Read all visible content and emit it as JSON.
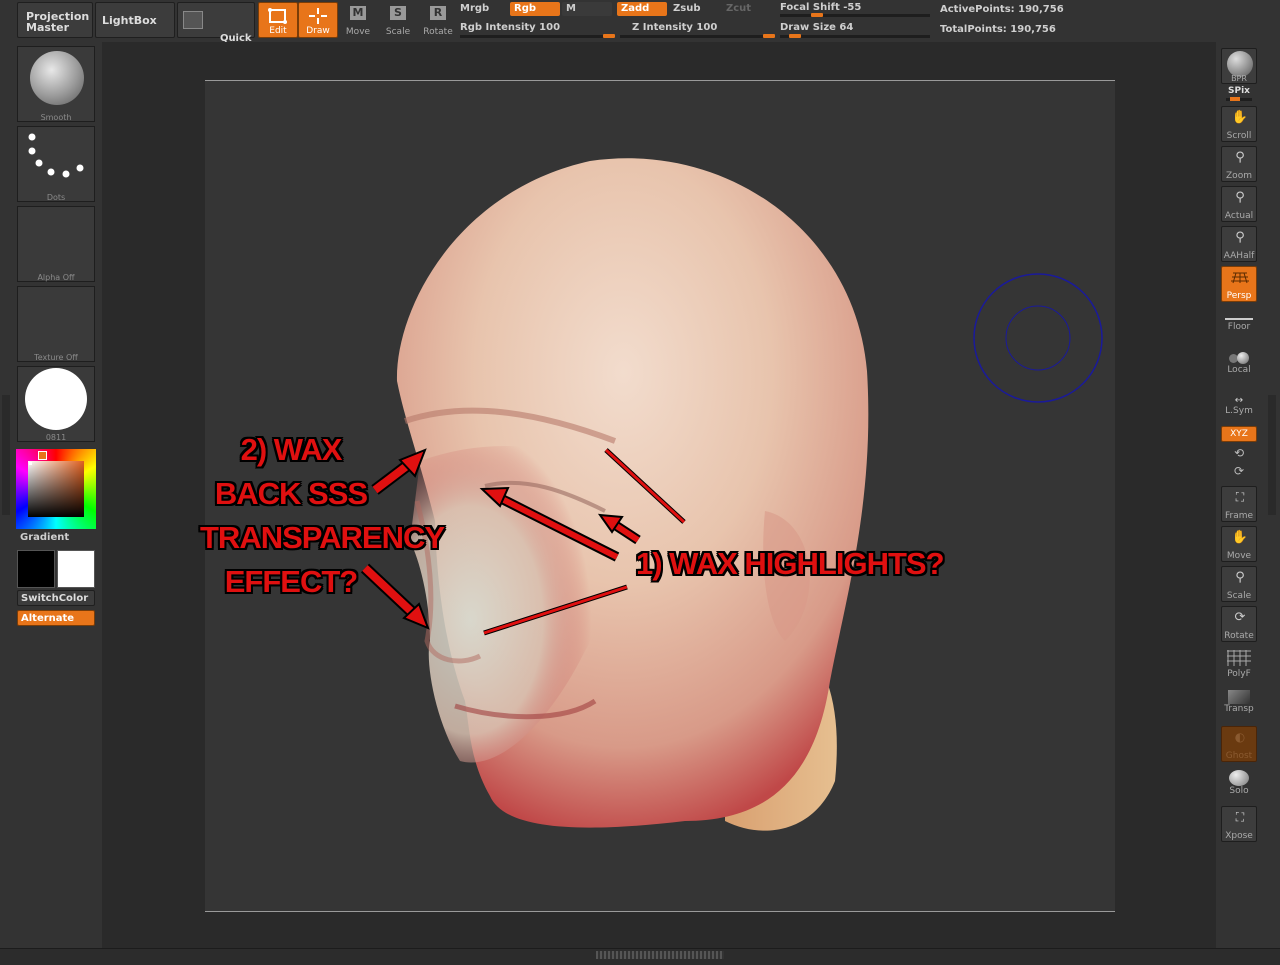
{
  "topbar": {
    "projection_master": "Projection\nMaster",
    "lightbox": "LightBox",
    "quick_sketch": "Quick\nSketch",
    "tools": [
      {
        "label": "Edit",
        "active": true
      },
      {
        "label": "Draw",
        "active": true
      },
      {
        "label": "Move",
        "active": false
      },
      {
        "label": "Scale",
        "active": false
      },
      {
        "label": "Rotate",
        "active": false
      }
    ],
    "mrgb": "Mrgb",
    "rgb": "Rgb",
    "m": "M",
    "rgb_intensity": "Rgb  Intensity 100",
    "zadd": "Zadd",
    "zsub": "Zsub",
    "zcut": "Zcut",
    "z_intensity": "Z  Intensity 100",
    "focal_shift": "Focal  Shift -55",
    "draw_size": "Draw  Size 64",
    "active_points": "ActivePoints: 190,756",
    "total_points": "TotalPoints: 190,756",
    "rgb_intensity_value": 100,
    "z_intensity_value": 100,
    "focal_shift_value": -55,
    "draw_size_value": 64
  },
  "leftpanel": {
    "brush_label": "Smooth",
    "stroke_label": "Dots",
    "alpha_label": "Alpha  Off",
    "texture_label": "Texture  Off",
    "material_label": "0811",
    "gradient_label": "Gradient",
    "switchcolor_label": "SwitchColor",
    "alternate_label": "Alternate"
  },
  "annotations": {
    "note2_lines": [
      "2) WAX",
      "BACK SSS",
      "TRANSPARENCY",
      "EFFECT?"
    ],
    "note1": "1) WAX HIGHLIGHTS?"
  },
  "rightpanel": {
    "bpr": "BPR",
    "spix": "SPix",
    "scroll": "Scroll",
    "zoom": "Zoom",
    "actual": "Actual",
    "aahalf": "AAHalf",
    "persp": "Persp",
    "floor": "Floor",
    "local": "Local",
    "lsym": "L.Sym",
    "xyz": "XYZ",
    "frame": "Frame",
    "move": "Move",
    "scale": "Scale",
    "rotate": "Rotate",
    "polyf": "PolyF",
    "transp": "Transp",
    "ghost": "Ghost",
    "solo": "Solo",
    "xpose": "Xpose"
  },
  "colors": {
    "accent": "#e8751a",
    "annotation": "#e01010",
    "brush_cursor": "#1a1a9a"
  }
}
